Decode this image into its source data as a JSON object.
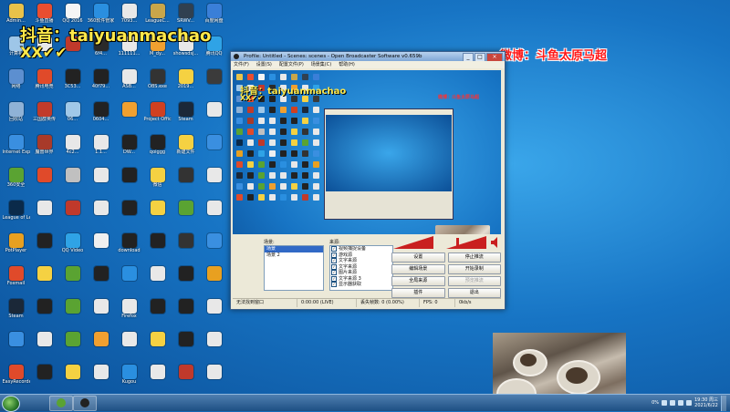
{
  "overlays": {
    "tiktok": "抖音：taiyuanmachao",
    "xx": "XX✔✔",
    "weibo": "微博：斗鱼太原马超"
  },
  "desktop": {
    "icons": [
      {
        "label": "Admin...",
        "color": "#e8c24a"
      },
      {
        "label": "斗鱼直播",
        "color": "#e94e30"
      },
      {
        "label": "QQ 2016",
        "color": "#f5f5f5"
      },
      {
        "label": "360软件管家",
        "color": "#2a8fe0"
      },
      {
        "label": "7093...",
        "color": "#e8e8e8"
      },
      {
        "label": "LeagueC...",
        "color": "#c9a64a"
      },
      {
        "label": "SRWV...",
        "color": "#304050"
      },
      {
        "label": "百度网盘",
        "color": "#3a7fd8"
      },
      {
        "label": "计算机",
        "color": "#9ec6e8"
      },
      {
        "label": "",
        "color": "#e8e8e8"
      },
      {
        "label": "",
        "color": "#c0392b"
      },
      {
        "label": "6f4...",
        "color": "#2a2a2a"
      },
      {
        "label": "111111...",
        "color": "#e8e8e8"
      },
      {
        "label": "M_dy...",
        "color": "#f0a030"
      },
      {
        "label": "showsdsj...",
        "color": "#e8e8e8"
      },
      {
        "label": "腾讯QQ",
        "color": "#2fa3e6"
      },
      {
        "label": "网络",
        "color": "#5c8fd0"
      },
      {
        "label": "腾讯电竞",
        "color": "#e04a2a"
      },
      {
        "label": "3C53...",
        "color": "#222222"
      },
      {
        "label": "40f79...",
        "color": "#222222"
      },
      {
        "label": "ASB...",
        "color": "#e8e8e8"
      },
      {
        "label": "OBS.exe",
        "color": "#333333"
      },
      {
        "label": "2019...",
        "color": "#f5d142"
      },
      {
        "label": "",
        "color": "#3b3b3b"
      },
      {
        "label": "回收站",
        "color": "#8fb2d6"
      },
      {
        "label": "三国群英传",
        "color": "#c23b2a"
      },
      {
        "label": "06...",
        "color": "#a0c8e8"
      },
      {
        "label": "0604...",
        "color": "#222222"
      },
      {
        "label": "",
        "color": "#f0a030"
      },
      {
        "label": "Project Officer",
        "color": "#d04020"
      },
      {
        "label": "Steam",
        "color": "#1b2838"
      },
      {
        "label": "",
        "color": "#e8e8e8"
      },
      {
        "label": "Internet Explorer",
        "color": "#3a8fe0"
      },
      {
        "label": "魔兽世界",
        "color": "#a83a2a"
      },
      {
        "label": "4c2...",
        "color": "#e8e8e8"
      },
      {
        "label": "1.1...",
        "color": "#e8e8e8"
      },
      {
        "label": "DW...",
        "color": "#222222"
      },
      {
        "label": "qoiggg",
        "color": "#222222"
      },
      {
        "label": "新建文件",
        "color": "#f5d142"
      },
      {
        "label": "",
        "color": "#3a8fe0"
      },
      {
        "label": "360安全",
        "color": "#5aa332"
      },
      {
        "label": "",
        "color": "#e04a2a"
      },
      {
        "label": "",
        "color": "#c0c0c0"
      },
      {
        "label": "",
        "color": "#e8e8e8"
      },
      {
        "label": "",
        "color": "#222222"
      },
      {
        "label": "微信",
        "color": "#f5d142"
      },
      {
        "label": "",
        "color": "#333333"
      },
      {
        "label": "",
        "color": "#e8e8e8"
      },
      {
        "label": "League of Legends",
        "color": "#0a2a4a"
      },
      {
        "label": "",
        "color": "#e8e8e8"
      },
      {
        "label": "",
        "color": "#c0392b"
      },
      {
        "label": "",
        "color": "#e8e8e8"
      },
      {
        "label": "",
        "color": "#222222"
      },
      {
        "label": "",
        "color": "#f5d142"
      },
      {
        "label": "",
        "color": "#5aa332"
      },
      {
        "label": "",
        "color": "#e8e8e8"
      },
      {
        "label": "PotPlayer",
        "color": "#e8a020"
      },
      {
        "label": "",
        "color": "#222222"
      },
      {
        "label": "QQ Video",
        "color": "#2fa3e6"
      },
      {
        "label": "",
        "color": "#f0f0f0"
      },
      {
        "label": "download",
        "color": "#222222"
      },
      {
        "label": "",
        "color": "#222222"
      },
      {
        "label": "",
        "color": "#333333"
      },
      {
        "label": "",
        "color": "#3a8fe0"
      },
      {
        "label": "Foxmail",
        "color": "#e04a2a"
      },
      {
        "label": "",
        "color": "#f5d142"
      },
      {
        "label": "",
        "color": "#5aa332"
      },
      {
        "label": "",
        "color": "#222222"
      },
      {
        "label": "",
        "color": "#2a8fe0"
      },
      {
        "label": "",
        "color": "#e8e8e8"
      },
      {
        "label": "",
        "color": "#222222"
      },
      {
        "label": "",
        "color": "#e8a020"
      },
      {
        "label": "Steam",
        "color": "#1b2838"
      },
      {
        "label": "",
        "color": "#222222"
      },
      {
        "label": "",
        "color": "#5aa332"
      },
      {
        "label": "",
        "color": "#e8e8e8"
      },
      {
        "label": "Firefox",
        "color": "#e8e8e8"
      },
      {
        "label": "",
        "color": "#222222"
      },
      {
        "label": "",
        "color": "#222222"
      },
      {
        "label": "",
        "color": "#e8e8e8"
      },
      {
        "label": "",
        "color": "#3a8fe0"
      },
      {
        "label": "",
        "color": "#e8e8e8"
      },
      {
        "label": "",
        "color": "#5aa332"
      },
      {
        "label": "",
        "color": "#f0a030"
      },
      {
        "label": "",
        "color": "#e8e8e8"
      },
      {
        "label": "",
        "color": "#f5d142"
      },
      {
        "label": "",
        "color": "#222222"
      },
      {
        "label": "",
        "color": "#e8e8e8"
      },
      {
        "label": "EasyRecorder",
        "color": "#e04a2a"
      },
      {
        "label": "",
        "color": "#222222"
      },
      {
        "label": "",
        "color": "#f5d142"
      },
      {
        "label": "",
        "color": "#e8e8e8"
      },
      {
        "label": "Kugou",
        "color": "#2a8fe0"
      },
      {
        "label": "",
        "color": "#e8e8e8"
      },
      {
        "label": "",
        "color": "#c0392b"
      },
      {
        "label": "",
        "color": "#e8e8e8"
      },
      {
        "label": "",
        "color": "#2a2a2a"
      },
      {
        "label": "",
        "color": "#f5d142"
      },
      {
        "label": "",
        "color": "#3a8fe0"
      },
      {
        "label": "",
        "color": "#222222"
      },
      {
        "label": "",
        "color": "#e8e8e8"
      },
      {
        "label": "",
        "color": "#f0a030"
      },
      {
        "label": "",
        "color": "#e8e8e8"
      },
      {
        "label": "",
        "color": "#e8e8e8"
      }
    ]
  },
  "obs": {
    "title": "Profile: Untitled - Scenes: scenes - Open Broadcaster Software v0.659b",
    "menu": [
      "文件(F)",
      "设置(S)",
      "配置文件(P)",
      "场景集(C)",
      "帮助(H)"
    ],
    "scenes_label": "场景:",
    "scenes": [
      {
        "name": "场景",
        "selected": true
      },
      {
        "name": "场景 2",
        "selected": false
      }
    ],
    "sources_label": "来源:",
    "sources": [
      "视频捕捉设备",
      "游戏源",
      "文字来源",
      "文字来源",
      "图片来源",
      "文字来源 3",
      "显示器获取"
    ],
    "buttons": [
      {
        "label": "设置",
        "enabled": true
      },
      {
        "label": "停止推流",
        "enabled": true
      },
      {
        "label": "编辑场景",
        "enabled": true
      },
      {
        "label": "开始录制",
        "enabled": true
      },
      {
        "label": "全局来源",
        "enabled": true
      },
      {
        "label": "预览推流",
        "enabled": false
      },
      {
        "label": "插件",
        "enabled": true
      },
      {
        "label": "退出",
        "enabled": true
      }
    ],
    "status": {
      "left": "无法找到窗口",
      "time": "0:00:00 (LIVE)",
      "dropped": "丢失帧数: 0 (0.00%)",
      "fps": "FPS: 0",
      "bitrate": "0kb/s"
    },
    "preview": {
      "tiktok": "抖音：taiyuanmachao",
      "xx": "XX✔✔",
      "weibo": "微博：斗鱼太原马超"
    }
  },
  "taskbar": {
    "clock_time": "19:30 周三",
    "clock_date": "2021/6/22",
    "volume_level": "0%",
    "items": [
      {
        "name": "360-browser",
        "color": "#5aa332"
      },
      {
        "name": "obs",
        "color": "#222222"
      }
    ]
  }
}
